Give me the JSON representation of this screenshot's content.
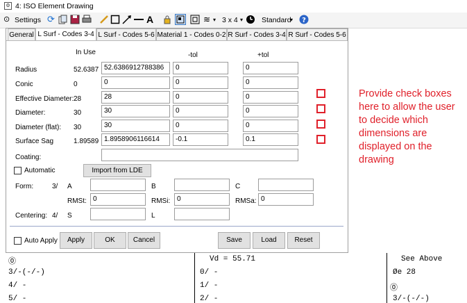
{
  "window": {
    "title": "4: ISO Element Drawing"
  },
  "toolbar": {
    "settings_label": "Settings",
    "layout_label": "3 x 4",
    "style_label": "Standard",
    "text_tool": "A"
  },
  "tabs": [
    {
      "label": "General"
    },
    {
      "label": "L Surf - Codes 3-4",
      "active": true
    },
    {
      "label": "L Surf - Codes 5-6"
    },
    {
      "label": "Material 1 - Codes 0-2"
    },
    {
      "label": "R Surf - Codes 3-4"
    },
    {
      "label": "R Surf - Codes 5-6"
    }
  ],
  "headers": {
    "in_use": "In Use",
    "minus_tol": "-tol",
    "plus_tol": "+tol"
  },
  "rows": [
    {
      "label": "Radius",
      "in_use": "52.6387",
      "value": "52.6386912788386",
      "minus": "0",
      "plus": "0"
    },
    {
      "label": "Conic",
      "in_use": "0",
      "value": "0",
      "minus": "0",
      "plus": "0"
    },
    {
      "label": "Effective Diameter:",
      "in_use": "28",
      "value": "28",
      "minus": "0",
      "plus": "0"
    },
    {
      "label": "Diameter:",
      "in_use": "30",
      "value": "30",
      "minus": "0",
      "plus": "0"
    },
    {
      "label": "Diameter (flat):",
      "in_use": "30",
      "value": "30",
      "minus": "0",
      "plus": "0"
    },
    {
      "label": "Surface Sag",
      "in_use": "1.89589",
      "value": "1.8958906116614",
      "minus": "-0.1",
      "plus": "0.1"
    }
  ],
  "coating": {
    "label": "Coating:",
    "value": ""
  },
  "automatic": {
    "label": "Automatic",
    "checked": false
  },
  "import_button": "Import from LDE",
  "form": {
    "label": "Form:",
    "code": "3/",
    "a_label": "A",
    "a_value": "",
    "b_label": "B",
    "b_value": "",
    "c_label": "C",
    "c_value": "",
    "rmst_label": "RMSt:",
    "rmst_value": "0",
    "rmsi_label": "RMSi:",
    "rmsi_value": "0",
    "rmsa_label": "RMSa:",
    "rmsa_value": "0"
  },
  "centering": {
    "label": "Centering:",
    "code": "4/",
    "s_label": "S",
    "s_value": "",
    "l_label": "L",
    "l_value": ""
  },
  "footer": {
    "auto_apply": "Auto Apply",
    "apply": "Apply",
    "ok": "OK",
    "cancel": "Cancel",
    "save": "Save",
    "load": "Load",
    "reset": "Reset"
  },
  "annotation": {
    "text": "Provide check boxes here to allow the user to decide which dimensions are displayed on the drawing",
    "color": "#e0202a"
  },
  "drawing_table": {
    "col1": [
      "⓪",
      "3/-(-/-)",
      "4/ -",
      "5/ -"
    ],
    "col2": [
      "Vd = 55.71",
      "0/ -",
      "1/ -",
      "2/ -"
    ],
    "col3": [
      "See Above",
      "Øe 28",
      "⓪",
      "3/-(-/-)"
    ]
  }
}
